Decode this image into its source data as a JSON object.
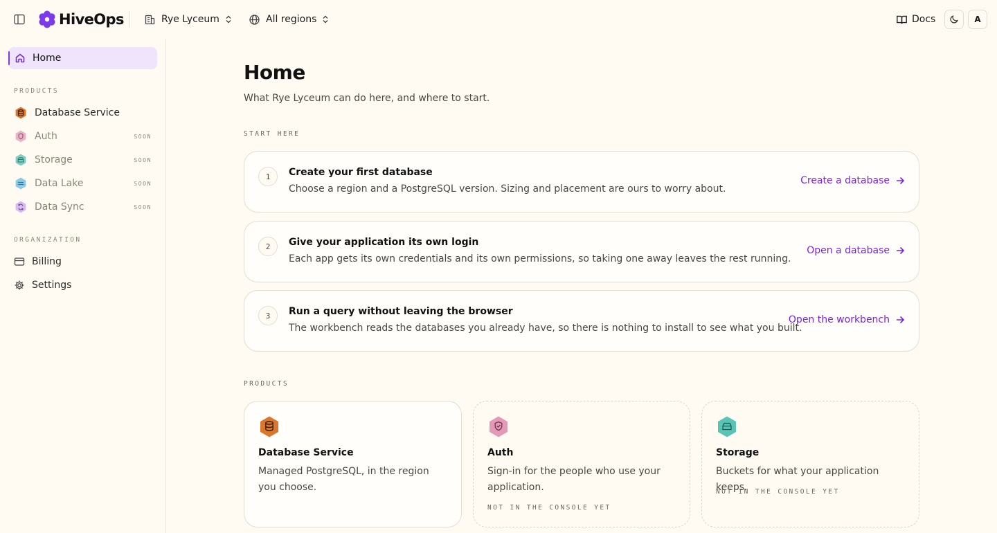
{
  "app": {
    "name": "HiveOps",
    "brand_color": "#7c3aed"
  },
  "topbar": {
    "org_name": "Rye Lyceum",
    "region": "All regions",
    "docs_label": "Docs",
    "avatar_initial": "A"
  },
  "sidebar": {
    "home_label": "Home",
    "products_label": "PRODUCTS",
    "products": [
      {
        "label": "Database Service",
        "badge": "",
        "icon": "database-hex-icon",
        "color": "#d9782d"
      },
      {
        "label": "Auth",
        "badge": "SOON",
        "icon": "shield-hex-icon",
        "color": "#e39ab7"
      },
      {
        "label": "Storage",
        "badge": "SOON",
        "icon": "storage-hex-icon",
        "color": "#58c4b5"
      },
      {
        "label": "Data Lake",
        "badge": "SOON",
        "icon": "lake-hex-icon",
        "color": "#64b8dc"
      },
      {
        "label": "Data Sync",
        "badge": "SOON",
        "icon": "sync-hex-icon",
        "color": "#c9a4e6"
      }
    ],
    "organization_label": "ORGANIZATION",
    "organization": [
      {
        "label": "Billing",
        "icon": "credit-card-icon"
      },
      {
        "label": "Settings",
        "icon": "gear-icon"
      }
    ]
  },
  "main": {
    "title": "Home",
    "subtitle": "What Rye Lyceum can do here, and where to start.",
    "start_label": "START HERE",
    "steps": [
      {
        "num": "1",
        "title": "Create your first database",
        "desc": "Choose a region and a PostgreSQL version. Sizing and placement are ours to worry about.",
        "link": "Create a database"
      },
      {
        "num": "2",
        "title": "Give your application its own login",
        "desc": "Each app gets its own credentials and its own permissions, so taking one away leaves the rest running.",
        "link": "Open a database"
      },
      {
        "num": "3",
        "title": "Run a query without leaving the browser",
        "desc": "The workbench reads the databases you already have, so there is nothing to install to see what you built.",
        "link": "Open the workbench"
      }
    ],
    "products_label": "PRODUCTS",
    "products": [
      {
        "name": "Database Service",
        "desc": "Managed PostgreSQL, in the region you choose.",
        "status": ""
      },
      {
        "name": "Auth",
        "desc": "Sign-in for the people who use your application.",
        "status": "NOT IN THE CONSOLE YET"
      },
      {
        "name": "Storage",
        "desc": "Buckets for what your application keeps.",
        "status": "NOT IN THE CONSOLE YET"
      }
    ]
  }
}
